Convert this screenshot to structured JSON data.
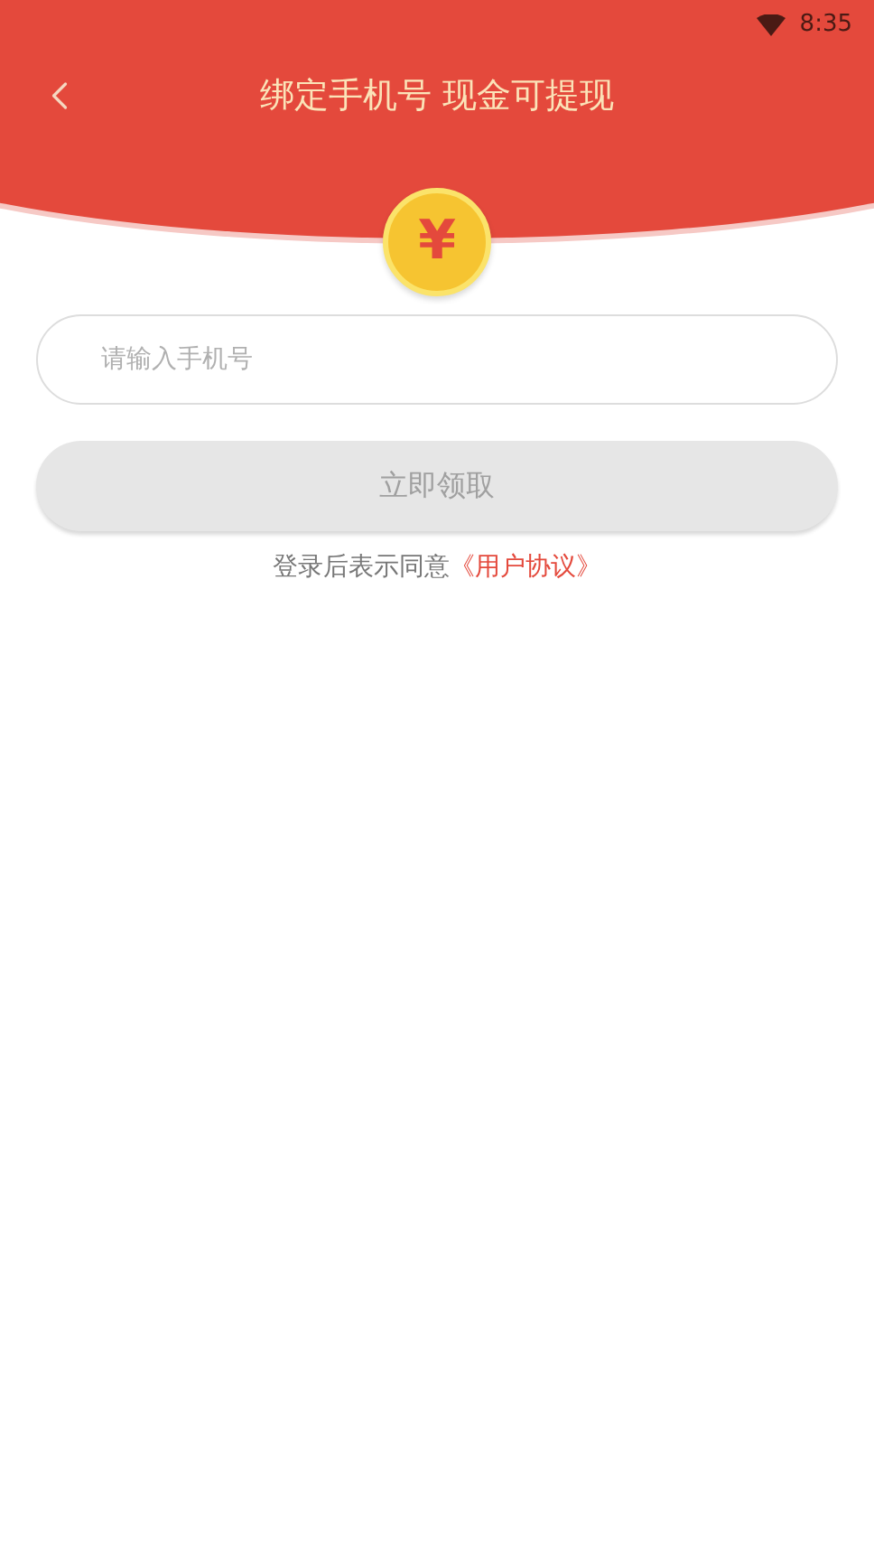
{
  "status_bar": {
    "time": "8:35"
  },
  "header": {
    "title": "绑定手机号 现金可提现"
  },
  "coin": {
    "symbol": "¥"
  },
  "phone_field": {
    "placeholder": "请输入手机号"
  },
  "submit_button": {
    "label": "立即领取",
    "disabled": true
  },
  "agreement": {
    "text": "登录后表示同意",
    "link": "《用户协议》"
  }
}
